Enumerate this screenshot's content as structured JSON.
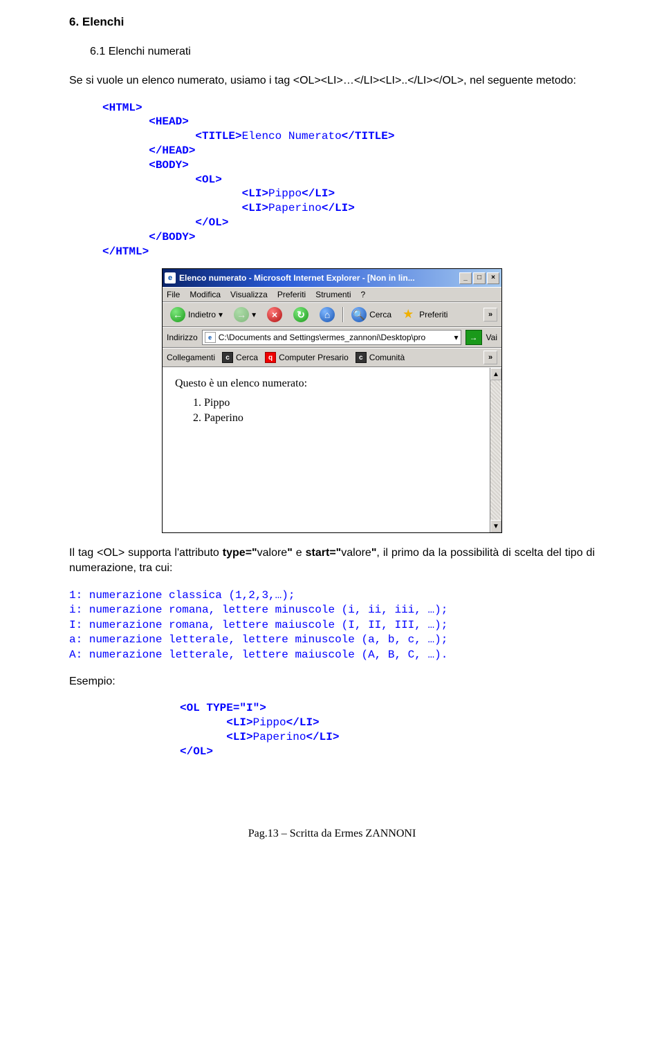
{
  "headings": {
    "h1": "6.  Elenchi",
    "h2_label": "6.1     Elenchi numerati"
  },
  "intro": {
    "pre": "Se si vuole un elenco numerato, usiamo i tag ",
    "tags": "<OL><LI>…</LI><LI>..</LI></OL>",
    "post": ", nel seguente metodo:"
  },
  "code1": {
    "l0": "<HTML>",
    "l1": "       <HEAD>",
    "l2a": "              <TITLE>",
    "l2b": "Elenco Numerato",
    "l2c": "</TITLE>",
    "l3": "       </HEAD>",
    "l4": "       <BODY>",
    "l5": "              <OL>",
    "l6a": "                     <LI>",
    "l6b": "Pippo",
    "l6c": "</LI>",
    "l7a": "                     <LI>",
    "l7b": "Paperino",
    "l7c": "</LI>",
    "l8": "              </OL>",
    "l9": "       </BODY>",
    "l10": "</HTML>"
  },
  "ie": {
    "title": "Elenco numerato - Microsoft Internet Explorer - [Non in lin...",
    "menu": [
      "File",
      "Modifica",
      "Visualizza",
      "Preferiti",
      "Strumenti",
      "?"
    ],
    "toolbar": {
      "back": "Indietro",
      "search": "Cerca",
      "fav": "Preferiti"
    },
    "addr_label": "Indirizzo",
    "addr_value": "C:\\Documents and Settings\\ermes_zannoni\\Desktop\\pro",
    "go": "Vai",
    "links_label": "Collegamenti",
    "links": [
      "Cerca",
      "Computer Presario",
      "Comunità"
    ],
    "content_title": "Questo è un elenco numerato:",
    "items": [
      "Pippo",
      "Paperino"
    ]
  },
  "para2": {
    "p1": "Il tag <OL> supporta l'attributo ",
    "b1": "type=\"",
    "p2": "valore",
    "b2": "\"",
    "p3": " e ",
    "b3": "start=\"",
    "p4": "valore",
    "b4": "\"",
    "p5": ", il primo da la possibilità di scelta del tipo di numerazione, tra cui:"
  },
  "numlist": {
    "l1": "1: numerazione classica (1,2,3,…);",
    "l2": "i: numerazione romana, lettere minuscole (i, ii, iii, …);",
    "l3": "I: numerazione romana, lettere maiuscole (I, II, III, …);",
    "l4": "a: numerazione letterale, lettere minuscole (a, b, c, …);",
    "l5": "A: numerazione letterale, lettere maiuscole (A, B, C, …)."
  },
  "esempio_label": "Esempio:",
  "code2": {
    "l0": "<OL TYPE=\"I\">",
    "l1a": "       <LI>",
    "l1b": "Pippo",
    "l1c": "</LI>",
    "l2a": "       <LI>",
    "l2b": "Paperino",
    "l2c": "</LI>",
    "l3": "</OL>"
  },
  "footer": "Pag.13 – Scritta da Ermes ZANNONI"
}
